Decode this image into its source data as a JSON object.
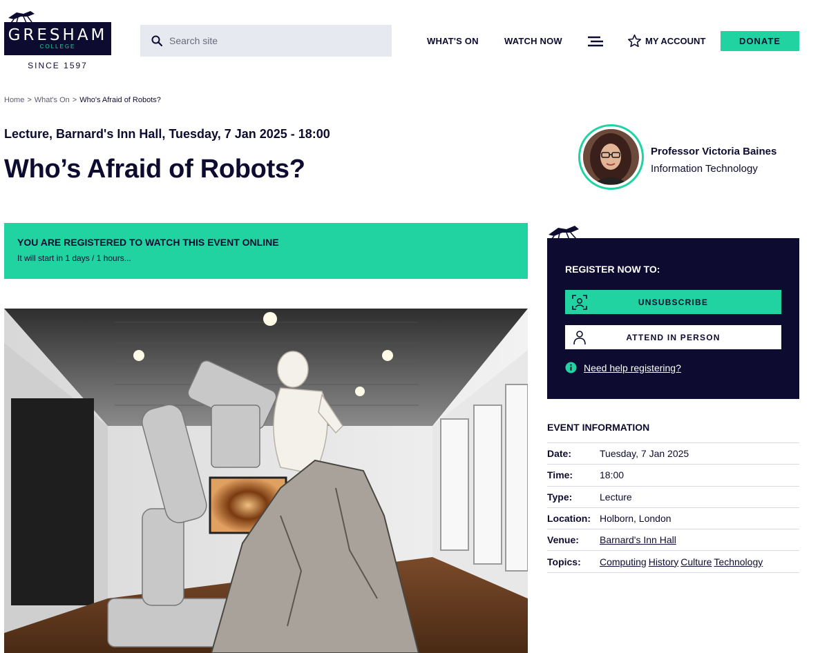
{
  "header": {
    "logo_main": "GRESHAM",
    "logo_sub": "COLLEGE",
    "logo_since": "SINCE 1597",
    "search_placeholder": "Search site",
    "nav": [
      "WHAT'S ON",
      "WATCH NOW"
    ],
    "account_label": "MY ACCOUNT",
    "donate_label": "DONATE"
  },
  "breadcrumb": {
    "items": [
      "Home",
      "What's On"
    ],
    "current": "Who's Afraid of Robots?"
  },
  "event": {
    "subtitle": "Lecture, Barnard's Inn Hall, Tuesday, 7 Jan 2025 - 18:00",
    "title": "Who’s Afraid of Robots?"
  },
  "speaker": {
    "name": "Professor Victoria Baines",
    "department": "Information Technology"
  },
  "banner": {
    "title": "YOU ARE REGISTERED TO WATCH THIS EVENT ONLINE",
    "subtitle": "It will start in 1 days / 1 hours..."
  },
  "register": {
    "title": "REGISTER NOW TO:",
    "unsubscribe_label": "UNSUBSCRIBE",
    "attend_label": "ATTEND IN PERSON",
    "help_label": "Need help registering?"
  },
  "info": {
    "title": "EVENT INFORMATION",
    "rows": {
      "date": {
        "label": "Date:",
        "value": "Tuesday, 7 Jan 2025"
      },
      "time": {
        "label": "Time:",
        "value": "18:00"
      },
      "type": {
        "label": "Type:",
        "value": "Lecture"
      },
      "location": {
        "label": "Location:",
        "value": "Holborn, London"
      },
      "venue": {
        "label": "Venue:",
        "value": "Barnard's Inn Hall"
      },
      "topics": {
        "label": "Topics:",
        "values": [
          "Computing",
          "History",
          "Culture",
          "Technology"
        ]
      }
    }
  },
  "colors": {
    "navy": "#0d0b2f",
    "green": "#20d3a0",
    "search_bg": "#e6e9f0"
  }
}
